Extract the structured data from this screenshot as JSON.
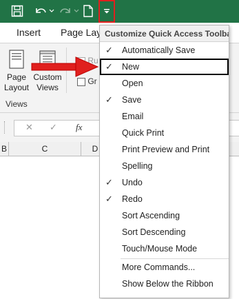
{
  "colors": {
    "titlebar": "#217346",
    "highlight_red": "#e0201e",
    "arrow_red": "#e0201e"
  },
  "qat": {
    "save_icon": "save-icon",
    "undo_icon": "undo-icon",
    "redo_icon": "redo-icon",
    "new_icon": "new-document-icon",
    "customize_icon": "chevron-down-icon"
  },
  "ribbon": {
    "tabs": [
      "Insert",
      "Page Layo"
    ],
    "group_label": "Views",
    "page_layout_label_1": "Page",
    "page_layout_label_2": "Layout",
    "custom_views_label_1": "Custom",
    "custom_views_label_2": "Views",
    "checkbox_ru": "Ru",
    "checkbox_gr": "Gr"
  },
  "formula_bar": {
    "cancel": "✕",
    "enter": "✓",
    "fx": "fx"
  },
  "columns": [
    "B",
    "C",
    "D"
  ],
  "menu": {
    "title": "Customize Quick Access Toolbar",
    "items": [
      {
        "label": "Automatically Save",
        "checked": "✓"
      },
      {
        "label": "New",
        "checked": "✓"
      },
      {
        "label": "Open",
        "checked": ""
      },
      {
        "label": "Save",
        "checked": "✓"
      },
      {
        "label": "Email",
        "checked": ""
      },
      {
        "label": "Quick Print",
        "checked": ""
      },
      {
        "label": "Print Preview and Print",
        "checked": ""
      },
      {
        "label": "Spelling",
        "checked": ""
      },
      {
        "label": "Undo",
        "checked": "✓"
      },
      {
        "label": "Redo",
        "checked": "✓"
      },
      {
        "label": "Sort Ascending",
        "checked": ""
      },
      {
        "label": "Sort Descending",
        "checked": ""
      },
      {
        "label": "Touch/Mouse Mode",
        "checked": ""
      },
      {
        "label": "More Commands...",
        "checked": ""
      },
      {
        "label": "Show Below the Ribbon",
        "checked": ""
      }
    ]
  }
}
